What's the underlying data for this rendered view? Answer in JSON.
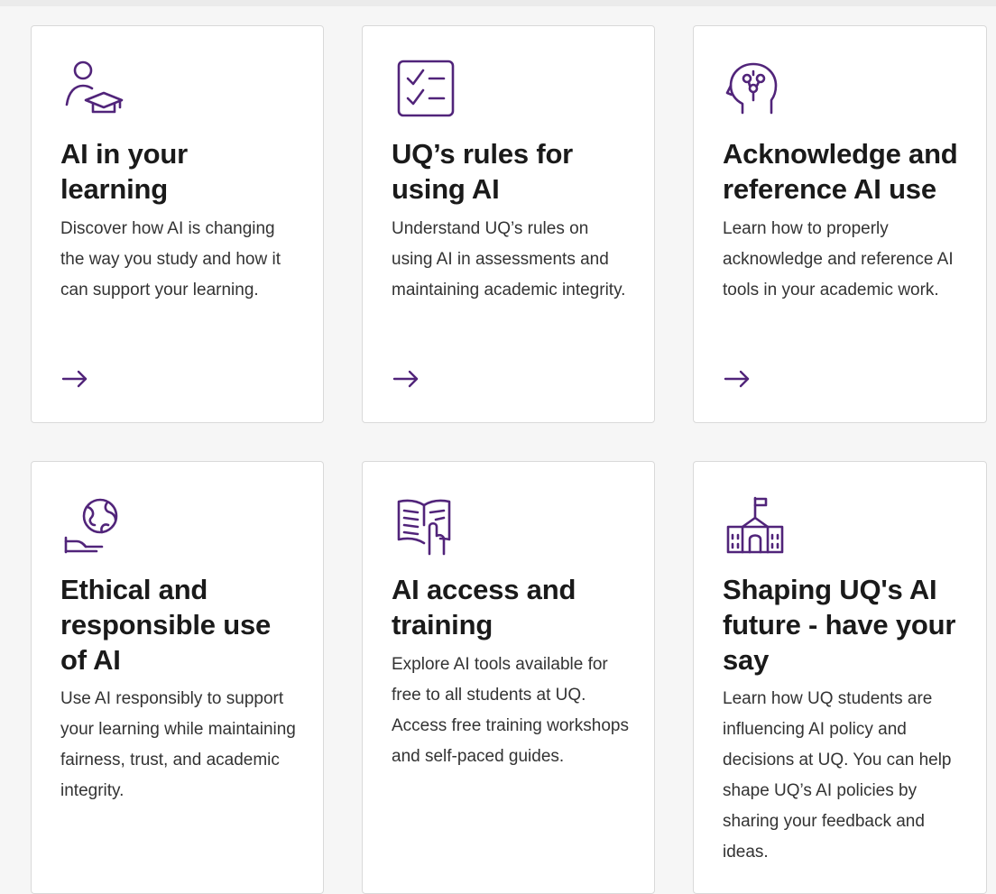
{
  "colors": {
    "accent": "#51247a",
    "title": "#1a1a1a",
    "text": "#333333",
    "card_border": "#d9d9d9",
    "background": "#f6f6f6"
  },
  "cards": [
    {
      "icon": "student-graduation-cap-icon",
      "title": "AI in your learning",
      "description": "Discover how AI is changing the way you study and how it can support your learning.",
      "link_icon": "arrow-right-icon"
    },
    {
      "icon": "checklist-icon",
      "title": "UQ’s rules for using AI",
      "description": "Understand UQ’s rules on using AI in assessments and maintaining academic integrity.",
      "link_icon": "arrow-right-icon"
    },
    {
      "icon": "brain-head-icon",
      "title": "Acknowledge and reference AI use",
      "description": "Learn how to properly acknowledge and reference AI tools in your academic work.",
      "link_icon": "arrow-right-icon"
    },
    {
      "icon": "hand-globe-icon",
      "title": "Ethical and responsible use of AI",
      "description": "Use AI responsibly to support your learning while maintaining fairness, trust, and academic integrity."
    },
    {
      "icon": "book-hand-icon",
      "title": "AI access and training",
      "description": "Explore AI tools available for free to all students at UQ. Access free training workshops and self-paced guides."
    },
    {
      "icon": "school-building-icon",
      "title": "Shaping UQ's AI future - have your say",
      "description": "Learn how UQ students are influencing AI policy and decisions at UQ. You can help shape UQ’s AI policies by sharing your feedback and ideas."
    }
  ]
}
